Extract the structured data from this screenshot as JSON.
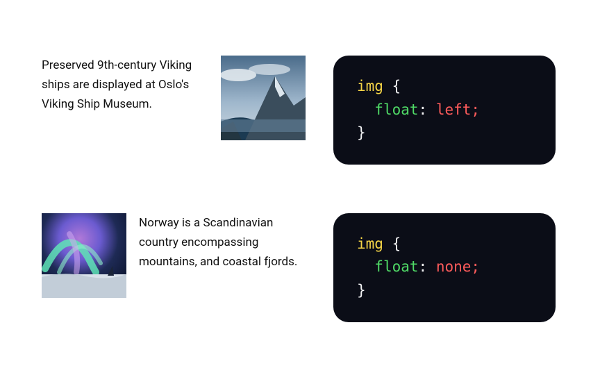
{
  "examples": [
    {
      "text": "Preserved 9th-century Viking ships are displayed at Oslo's Viking Ship Museum.",
      "image_alt": "mountain-fjord",
      "code": {
        "selector": "img",
        "property": "float",
        "value": "left"
      }
    },
    {
      "text": "Norway is a Scandinavian country encompassing mountains, and coastal fjords.",
      "image_alt": "aurora",
      "code": {
        "selector": "img",
        "property": "float",
        "value": "none"
      }
    }
  ]
}
